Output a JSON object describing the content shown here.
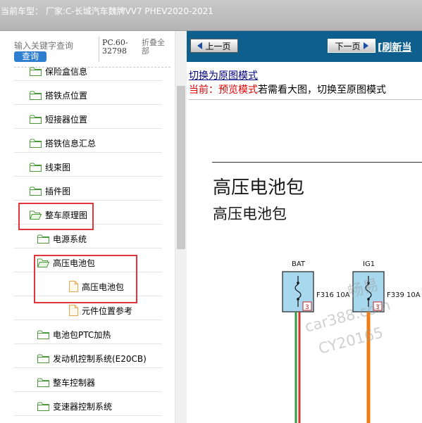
{
  "titlebar": {
    "text": "当前车型： 厂家:C-长城汽车魏牌VV7 PHEV2020-2021"
  },
  "search": {
    "placeholder": "输入关键字查询",
    "button_label": "查询",
    "code": "PC.60-32798",
    "collapse_label": "折叠全部"
  },
  "tree": [
    {
      "label": "保险盒信息",
      "icon": "folder-icon"
    },
    {
      "label": "搭铁点位置",
      "icon": "folder-icon"
    },
    {
      "label": "短接器位置",
      "icon": "folder-icon"
    },
    {
      "label": "搭铁信息汇总",
      "icon": "folder-icon"
    },
    {
      "label": "线束图",
      "icon": "folder-icon"
    },
    {
      "label": "插件图",
      "icon": "folder-icon"
    },
    {
      "label": "整车原理图",
      "icon": "folder-open-icon"
    },
    {
      "label": "电源系统",
      "icon": "folder-icon"
    },
    {
      "label": "高压电池包",
      "icon": "folder-open-icon"
    },
    {
      "label": "高压电池包",
      "icon": "document-icon"
    },
    {
      "label": "元件位置参考",
      "icon": "document-icon"
    },
    {
      "label": "电池包PTC加热",
      "icon": "folder-icon"
    },
    {
      "label": "发动机控制系统(E20CB)",
      "icon": "folder-icon"
    },
    {
      "label": "整车控制器",
      "icon": "folder-icon"
    },
    {
      "label": "变速器控制系统",
      "icon": "folder-icon"
    }
  ],
  "nav": {
    "prev_label": "上一页",
    "next_label": "下一页",
    "refresh_label": "[刷新当"
  },
  "viewer": {
    "mode_link": "切换为原图模式",
    "status_label": "当前：",
    "status_mode": "预览模式",
    "status_hint": "若需看大图，切换至原图模式"
  },
  "diagram": {
    "title": "高压电池包",
    "subtitle": "高压电池包",
    "fuses": [
      {
        "supply": "BAT",
        "name": "F316",
        "rating": "10A",
        "pin": "3"
      },
      {
        "supply": "IG1",
        "name": "F339",
        "rating": "10A",
        "pin": "3"
      }
    ],
    "watermark_lines": [
      "畅易",
      "car388.com",
      "CY20165"
    ]
  },
  "colors": {
    "nav_bar": "#0e5f8e",
    "highlight_box": "#e0363b",
    "search_button": "#2f7fd0",
    "fuse_fill": "#a8d8ee",
    "wire_green": "#2e9a42",
    "wire_red": "#d4362a",
    "wire_orange": "#ef7d14"
  }
}
